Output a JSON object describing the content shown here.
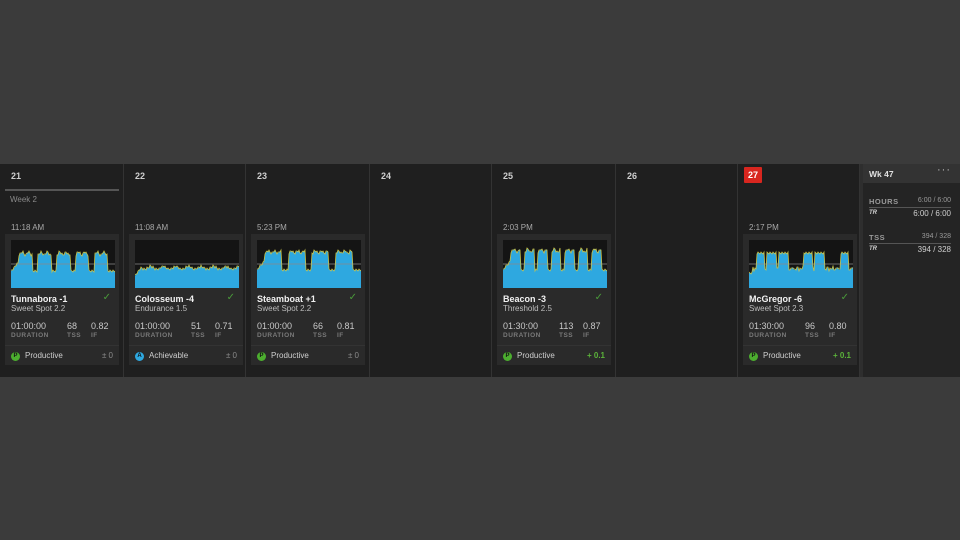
{
  "colors": {
    "background": "#3b3b3b",
    "calendar_bg": "#1f1f1f",
    "card_bg": "#2a2a2a",
    "today": "#d8261f",
    "power_fill": "#2ea8e0",
    "power_line": "#c8c24a",
    "ftp_line": "#8a8a8a",
    "productive": "#4cae2f",
    "achievable": "#2ea8e0",
    "completed_check": "#4a9a3a"
  },
  "calendar": {
    "week_label": "Week 2",
    "days": [
      {
        "number": "21",
        "today": false,
        "has_week_label": true,
        "workout": {
          "time": "11:18 AM",
          "name": "Tunnabora -1",
          "type": "Sweet Spot 2.2",
          "completed_icon": "check-icon",
          "duration": "01:00:00",
          "tss": "68",
          "if": "0.82",
          "labels": {
            "duration": "DURATION",
            "tss": "TSS",
            "if": "IF"
          },
          "progression": {
            "badge": "P",
            "label": "Productive",
            "delta": "± 0",
            "delta_positive": false,
            "kind": "productive"
          },
          "profile": {
            "shape": "blocks",
            "intervals": 5,
            "base": 0.35,
            "work": 0.72
          }
        }
      },
      {
        "number": "22",
        "today": false,
        "has_week_label": false,
        "workout": {
          "time": "11:08 AM",
          "name": "Colosseum -4",
          "type": "Endurance 1.5",
          "completed_icon": "check-icon",
          "duration": "01:00:00",
          "tss": "51",
          "if": "0.71",
          "labels": {
            "duration": "DURATION",
            "tss": "TSS",
            "if": "IF"
          },
          "progression": {
            "badge": "A",
            "label": "Achievable",
            "delta": "± 0",
            "delta_positive": false,
            "kind": "achievable"
          },
          "profile": {
            "shape": "steady",
            "intervals": 0,
            "base": 0.42,
            "work": 0.42
          }
        }
      },
      {
        "number": "23",
        "today": false,
        "has_week_label": false,
        "workout": {
          "time": "5:23 PM",
          "name": "Steamboat +1",
          "type": "Sweet Spot 2.2",
          "completed_icon": "check-icon",
          "duration": "01:00:00",
          "tss": "66",
          "if": "0.81",
          "labels": {
            "duration": "DURATION",
            "tss": "TSS",
            "if": "IF"
          },
          "progression": {
            "badge": "P",
            "label": "Productive",
            "delta": "± 0",
            "delta_positive": false,
            "kind": "productive"
          },
          "profile": {
            "shape": "blocks",
            "intervals": 4,
            "base": 0.38,
            "work": 0.75
          }
        }
      },
      {
        "number": "24",
        "today": false,
        "has_week_label": false,
        "workout": null
      },
      {
        "number": "25",
        "today": false,
        "has_week_label": false,
        "workout": {
          "time": "2:03 PM",
          "name": "Beacon -3",
          "type": "Threshold 2.5",
          "completed_icon": "check-icon",
          "duration": "01:30:00",
          "tss": "113",
          "if": "0.87",
          "labels": {
            "duration": "DURATION",
            "tss": "TSS",
            "if": "IF"
          },
          "progression": {
            "badge": "P",
            "label": "Productive",
            "delta": "+ 0.1",
            "delta_positive": true,
            "kind": "productive"
          },
          "profile": {
            "shape": "blocks",
            "intervals": 7,
            "base": 0.38,
            "work": 0.78
          }
        }
      },
      {
        "number": "26",
        "today": false,
        "has_week_label": false,
        "workout": null
      },
      {
        "number": "27",
        "today": true,
        "has_week_label": false,
        "workout": {
          "time": "2:17 PM",
          "name": "McGregor -6",
          "type": "Sweet Spot 2.3",
          "completed_icon": "check-icon",
          "duration": "01:30:00",
          "tss": "96",
          "if": "0.80",
          "labels": {
            "duration": "DURATION",
            "tss": "TSS",
            "if": "IF"
          },
          "progression": {
            "badge": "P",
            "label": "Productive",
            "delta": "+ 0.1",
            "delta_positive": true,
            "kind": "productive"
          },
          "profile": {
            "shape": "pairs",
            "intervals": 3,
            "base": 0.38,
            "work": 0.72
          }
        }
      }
    ]
  },
  "week_summary": {
    "title": "Wk 47",
    "menu_icon": "more-icon",
    "hours": {
      "label": "HOURS",
      "planned": "6:00 / 6:00",
      "tr_badge": "TR",
      "value": "6:00 / 6:00"
    },
    "tss": {
      "label": "TSS",
      "planned": "394 / 328",
      "tr_badge": "TR",
      "value": "394 / 328"
    }
  }
}
